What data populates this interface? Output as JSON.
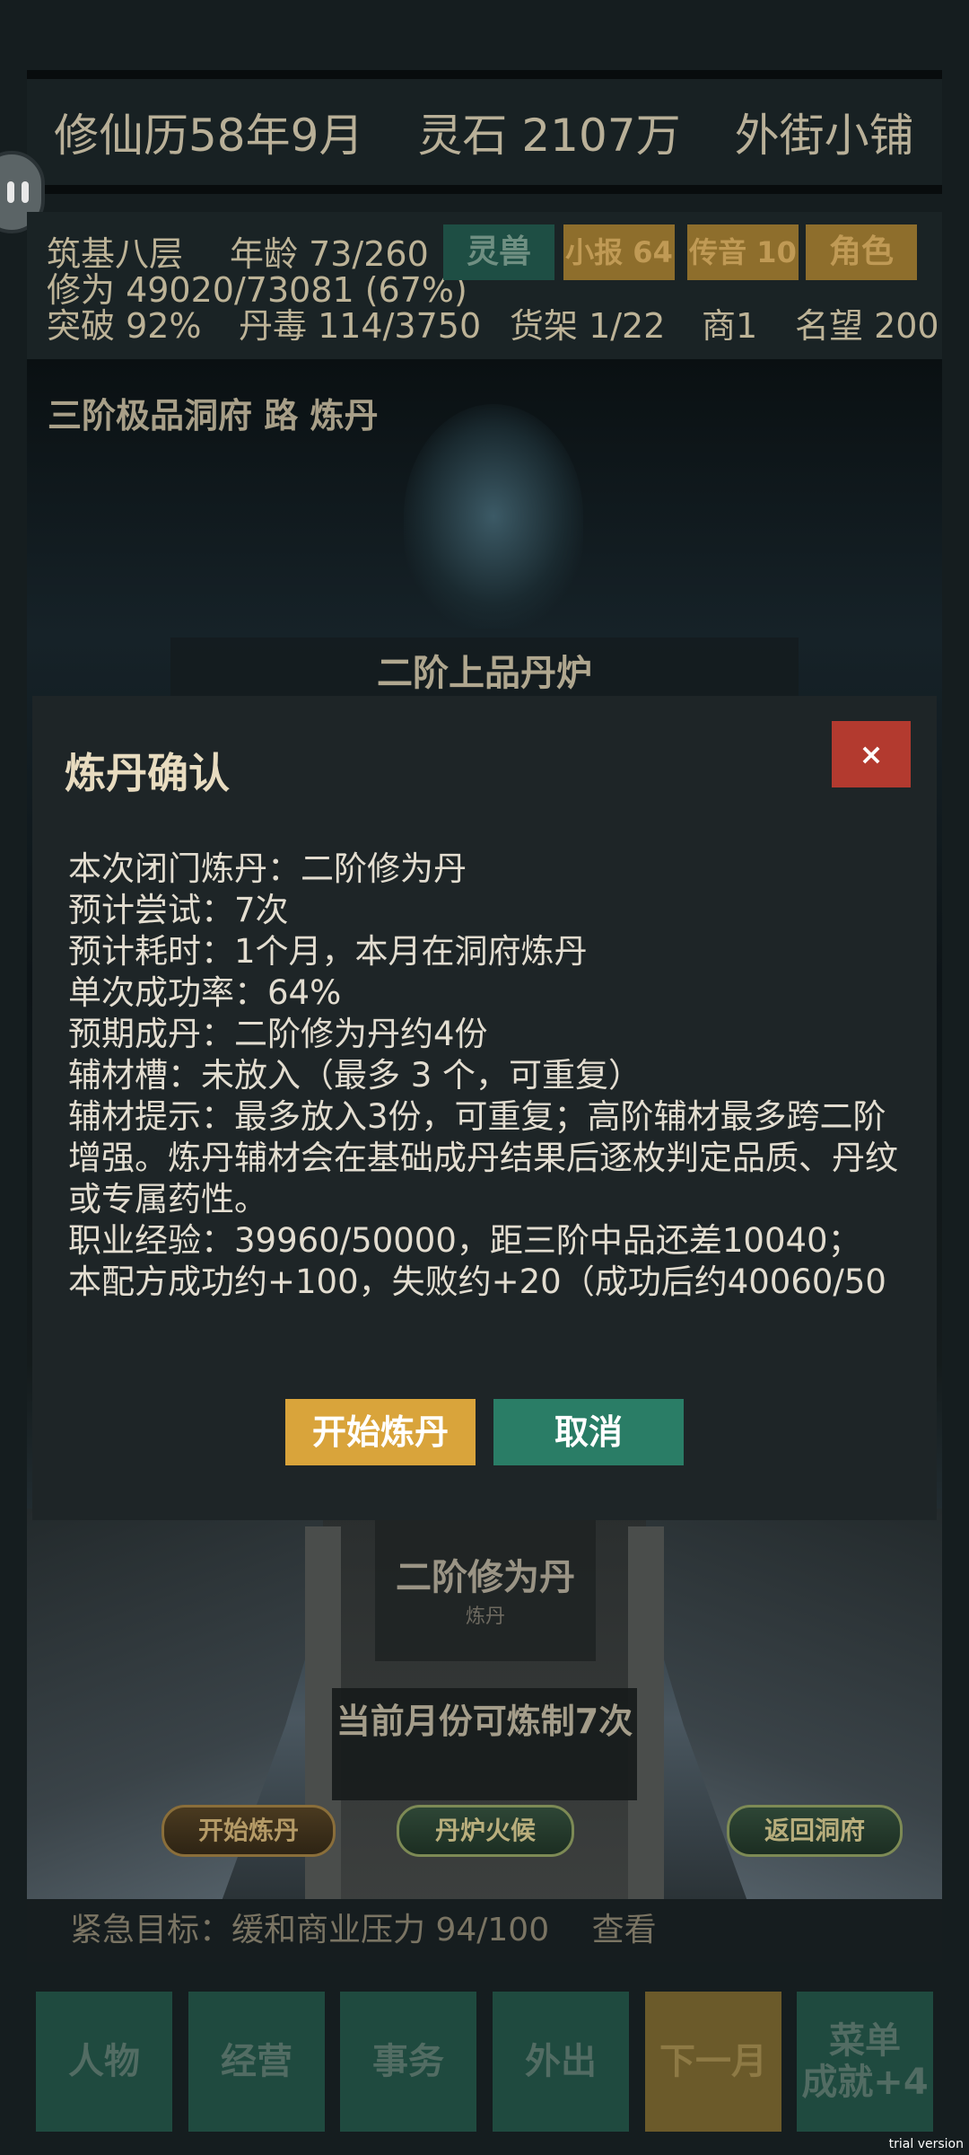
{
  "header": {
    "date": "修仙历58年9月",
    "spirit_stones": "灵石 2107万",
    "location": "外街小铺"
  },
  "stats": {
    "realm": "筑基八层",
    "age": "年龄 73/260",
    "cultivation": "修为 49020/73081 (67%)",
    "breakthrough": "突破 92%",
    "pill_toxin": "丹毒 114/3750",
    "shelf": "货架 1/22",
    "merchant": "商1",
    "reputation": "名望 200"
  },
  "tags": {
    "beast": "灵兽",
    "news": "小报 64",
    "message": "传音 10",
    "role": "角色"
  },
  "scene": {
    "title": "三阶极品洞府 路 炼丹",
    "furnace": "二阶上品丹炉",
    "pill_name": "二阶修为丹",
    "pill_sub": "炼丹",
    "months_note": "当前月份可炼制7次",
    "btn_start": "开始炼丹",
    "btn_heat": "丹炉火候",
    "btn_return": "返回洞府"
  },
  "urgent": {
    "text": "紧急目标：缓和商业压力 94/100",
    "link": "查看"
  },
  "nav": {
    "character": "人物",
    "business": "经营",
    "affairs": "事务",
    "outing": "外出",
    "next_month": "下一月",
    "menu": "菜单",
    "achievement": "成就+4"
  },
  "modal": {
    "title": "炼丹确认",
    "close": "×",
    "lines": [
      "本次闭门炼丹：二阶修为丹",
      "预计尝试：7次",
      "预计耗时：1个月，本月在洞府炼丹",
      "单次成功率：64%",
      "预期成丹：二阶修为丹约4份",
      "辅材槽：未放入（最多 3 个，可重复）"
    ],
    "tip": "辅材提示：最多放入3份，可重复；高阶辅材最多跨二阶增强。炼丹辅材会在基础成丹结果后逐枚判定品质、丹纹或专属药性。",
    "exp": "职业经验：39960/50000，距三阶中品还差10040；",
    "exp2": "本配方成功约+100，失败约+20（成功后约40060/50",
    "confirm": "开始炼丹",
    "cancel": "取消"
  },
  "watermark": "trial version",
  "colors": {
    "gold": "#d9a43b",
    "green": "#2a7d66",
    "red": "#b33a2f",
    "tag_gold": "#8e6e2c",
    "tag_green": "#1e4e44"
  }
}
